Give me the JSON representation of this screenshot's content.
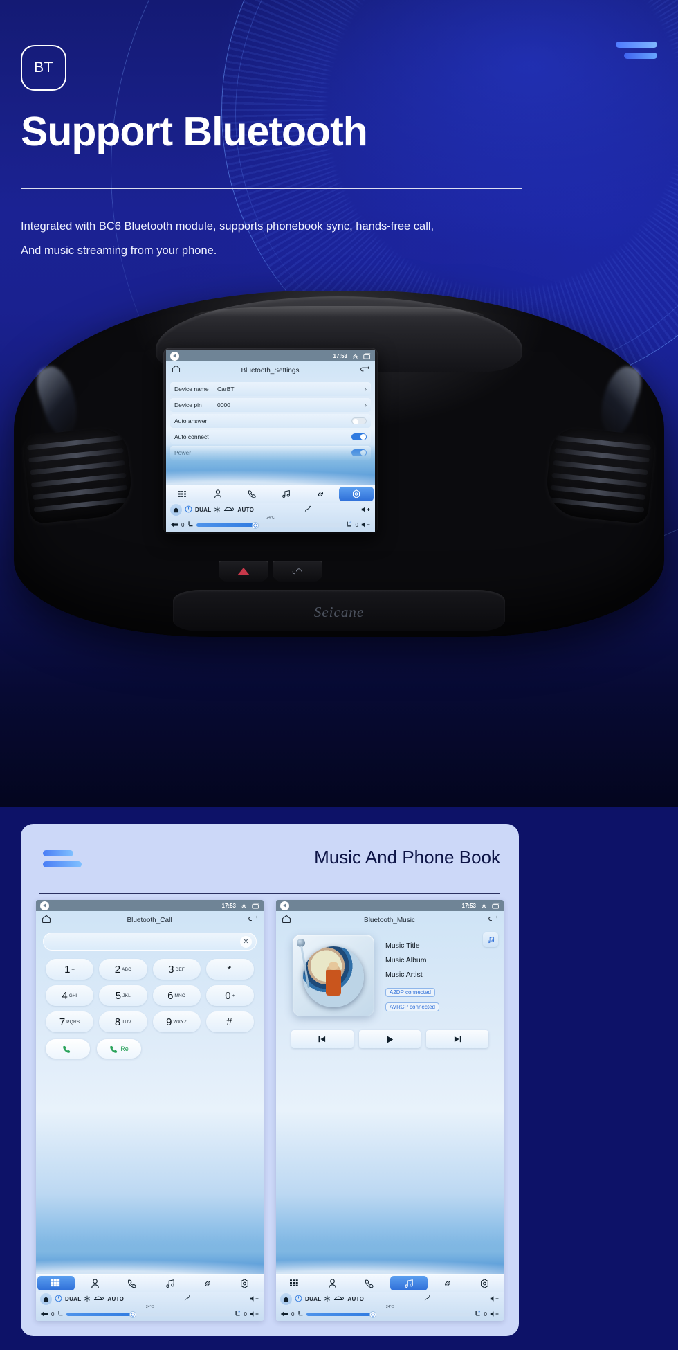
{
  "hero": {
    "badge": "BT",
    "title": "Support Bluetooth",
    "desc_line1": "Integrated with BC6 Bluetooth module, supports phonebook sync, hands-free call,",
    "desc_line2": "And music streaming from your phone.",
    "brand": "Seicane"
  },
  "center_unit": {
    "status_time": "17:53",
    "app_title": "Bluetooth_Settings",
    "rows": [
      {
        "key": "Device name",
        "value": "CarBT",
        "type": "chevron",
        "chevron": "›"
      },
      {
        "key": "Device pin",
        "value": "0000",
        "type": "chevron",
        "chevron": "›"
      },
      {
        "key": "Auto answer",
        "value": "",
        "type": "toggle",
        "state": "off"
      },
      {
        "key": "Auto connect",
        "value": "",
        "type": "toggle",
        "state": "on"
      },
      {
        "key": "Power",
        "value": "",
        "type": "toggle",
        "state": "on"
      }
    ],
    "nav_icons": [
      "apps-icon",
      "contacts-icon",
      "phone-icon",
      "music-icon",
      "link-icon",
      "settings-icon"
    ],
    "nav_active_index": 5,
    "hvac": {
      "power": "power-icon",
      "dual": "DUAL",
      "ac": "snowflake-icon",
      "recirc": "recirculate-icon",
      "auto": "AUTO",
      "defrost": "defrost-icon",
      "vol_up": "volume-up-icon",
      "vol_down": "volume-down-icon",
      "temp": "24°C",
      "left_fan": "0",
      "right_fan": "0",
      "seat_left": "seat-icon",
      "seat_right": "seat-heater-icon",
      "home": "home-icon",
      "back": "back-arrow-icon"
    }
  },
  "card": {
    "title": "Music And Phone Book",
    "call_unit": {
      "status_time": "17:53",
      "app_title": "Bluetooth_Call",
      "input_value": "",
      "clear_icon": "close-icon",
      "keys": [
        {
          "digit": "1",
          "sub": "--"
        },
        {
          "digit": "2",
          "sub": "ABC"
        },
        {
          "digit": "3",
          "sub": "DEF"
        },
        {
          "digit": "*",
          "sub": ""
        },
        {
          "digit": "4",
          "sub": "GHI"
        },
        {
          "digit": "5",
          "sub": "JKL"
        },
        {
          "digit": "6",
          "sub": "MNO"
        },
        {
          "digit": "0",
          "sub": "+"
        },
        {
          "digit": "7",
          "sub": "PQRS"
        },
        {
          "digit": "8",
          "sub": "TUV"
        },
        {
          "digit": "9",
          "sub": "WXYZ"
        },
        {
          "digit": "#",
          "sub": ""
        }
      ],
      "dial_label": "",
      "redial_label": "Re",
      "nav_icons": [
        "apps-icon",
        "contacts-icon",
        "phone-icon",
        "music-icon",
        "link-icon",
        "settings-icon"
      ],
      "nav_active_index": 0,
      "hvac": {
        "dual": "DUAL",
        "auto": "AUTO",
        "temp": "24°C",
        "left_fan": "0",
        "right_fan": "0"
      }
    },
    "music_unit": {
      "status_time": "17:53",
      "app_title": "Bluetooth_Music",
      "playlist_icon": "music-note-icon",
      "track_title": "Music Title",
      "track_album": "Music Album",
      "track_artist": "Music Artist",
      "badge_a2dp": "A2DP  connected",
      "badge_avrcp": "AVRCP connected",
      "transport": [
        "prev-icon",
        "play-icon",
        "next-icon"
      ],
      "nav_icons": [
        "apps-icon",
        "contacts-icon",
        "phone-icon",
        "music-icon",
        "link-icon",
        "settings-icon"
      ],
      "nav_active_index": 3,
      "hvac": {
        "dual": "DUAL",
        "auto": "AUTO",
        "temp": "24°C",
        "left_fan": "0",
        "right_fan": "0"
      }
    }
  },
  "colors": {
    "hero_bg": "#1b2293",
    "card_bg": "#ccd8f8",
    "accent_blue": "#2f7ae0",
    "title_navy": "#0d1446",
    "status_bar": "#6f8496"
  }
}
